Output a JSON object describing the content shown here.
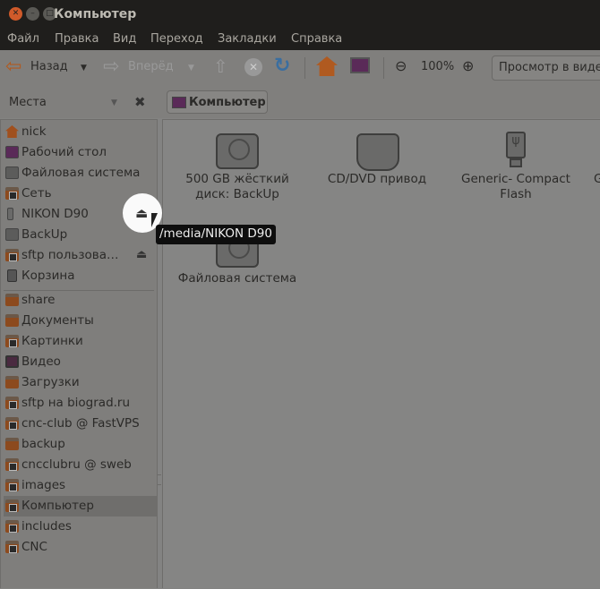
{
  "window": {
    "title": "Компьютер",
    "colors": {
      "titlebar": "#1f1e1c",
      "close": "#d05a2a"
    }
  },
  "menu": [
    "Файл",
    "Правка",
    "Вид",
    "Переход",
    "Закладки",
    "Справка"
  ],
  "toolbar": {
    "back": "Назад",
    "forward": "Вперёд",
    "zoom": "100%",
    "view": "Просмотр в виде значков"
  },
  "location": {
    "places_label": "Места",
    "path": "Компьютер"
  },
  "sidebar": {
    "devices": [
      {
        "label": "nick",
        "icon": "home-icon"
      },
      {
        "label": "Рабочий стол",
        "icon": "desktop-icon"
      },
      {
        "label": "Файловая система",
        "icon": "drive-icon"
      },
      {
        "label": "Сеть",
        "icon": "network-folder-icon"
      },
      {
        "label": "NIKON D90",
        "icon": "usb-icon",
        "eject": true
      },
      {
        "label": "BackUp",
        "icon": "drive-icon"
      },
      {
        "label": "sftp пользова…",
        "icon": "network-folder-icon",
        "eject": true
      },
      {
        "label": "Корзина",
        "icon": "trash-icon"
      }
    ],
    "bookmarks": [
      {
        "label": "share",
        "icon": "folder-icon"
      },
      {
        "label": "Документы",
        "icon": "documents-folder-icon"
      },
      {
        "label": "Картинки",
        "icon": "pictures-folder-icon"
      },
      {
        "label": "Видео",
        "icon": "video-folder-icon"
      },
      {
        "label": "Загрузки",
        "icon": "downloads-folder-icon"
      },
      {
        "label": "sftp на biograd.ru",
        "icon": "network-folder-icon"
      },
      {
        "label": "cnc-club @ FastVPS",
        "icon": "network-folder-icon"
      },
      {
        "label": "backup",
        "icon": "folder-icon"
      },
      {
        "label": "cncclubru @ sweb",
        "icon": "network-folder-icon"
      },
      {
        "label": "images",
        "icon": "network-folder-icon"
      },
      {
        "label": "Компьютер",
        "icon": "network-folder-icon",
        "selected": true
      },
      {
        "label": "includes",
        "icon": "network-folder-icon"
      },
      {
        "label": "CNC",
        "icon": "network-folder-icon"
      }
    ]
  },
  "items": [
    {
      "label": "500 GB жёсткий диск: BackUp",
      "icon": "hdd-icon"
    },
    {
      "label": "CD/DVD привод",
      "icon": "optical-drive-icon"
    },
    {
      "label": "Generic- Compact Flash",
      "icon": "usb-drive-icon"
    },
    {
      "label": "G",
      "icon": "drive-icon"
    },
    {
      "label": "Файловая система",
      "icon": "hdd-icon"
    }
  ],
  "tooltip": "/media/NIKON D90"
}
